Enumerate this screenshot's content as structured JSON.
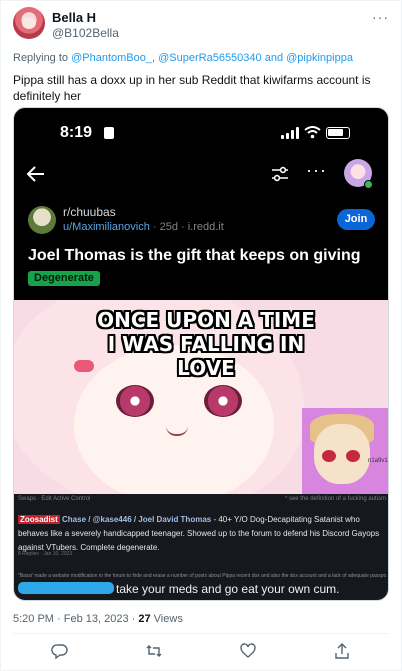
{
  "author": {
    "display_name": "Bella H",
    "handle": "@B102Bella",
    "avatar_icon": "avatar-icon"
  },
  "reply": {
    "prefix": "Replying to",
    "mention_1": "@PhantomBoo_",
    "mention_2": "@SuperRa56550340",
    "conjunction": "and",
    "mention_3": "@pipkinpippa"
  },
  "tweet": {
    "text": "Pippa still has a doxx up in her sub Reddit that kiwifarms account is definitely her"
  },
  "screenshot": {
    "status_time": "8:19",
    "subreddit": "r/chuubas",
    "post_author": "u/Maximilianovich",
    "post_age": "· 25d · i.redd.it",
    "join_label": "Join",
    "post_title": "Joel Thomas is the gift that keeps on giving",
    "flair": "Degenerate",
    "meme_caption_line1": "ONCE UPON A TIME",
    "meme_caption_line2": "I WAS FALLING IN LOVE",
    "inset_tag": "n1a9v1",
    "forum_header_left": "Swaps · Edit Active Control",
    "forum_header_right": "* see the definition of a fucking autism",
    "forum_tag": "Zoosadist",
    "forum_name": "Chase / @kase446 / Joel David Thomas",
    "forum_body": " - 40+ Y/O Dog-Decapitating Satanist who behaves like a severely handicapped teenager. Showed up to the forum to defend his Discord Gayops against VTubers. Complete degenerate.",
    "forum_meta": "8 Replies · Jan 10, 2023",
    "forum_small_line": "\"Bassi' made a website modification to the forum to hide and erase a number of posts about Pippa recent dox and also the dox account and a lack of adequate passports to explain whose.\"",
    "forum_bottom_text": "take your meds and go eat your own cum."
  },
  "meta": {
    "timestamp": "5:20 PM · Feb 13, 2023 ·",
    "views_count": "27",
    "views_label": "Views"
  },
  "actions": [
    "reply-icon",
    "retweet-icon",
    "like-icon",
    "share-icon"
  ],
  "colors": {
    "link": "#1d9bf0",
    "muted": "#536471",
    "reddit_join": "#0a66d8",
    "flair": "#16a34a"
  }
}
